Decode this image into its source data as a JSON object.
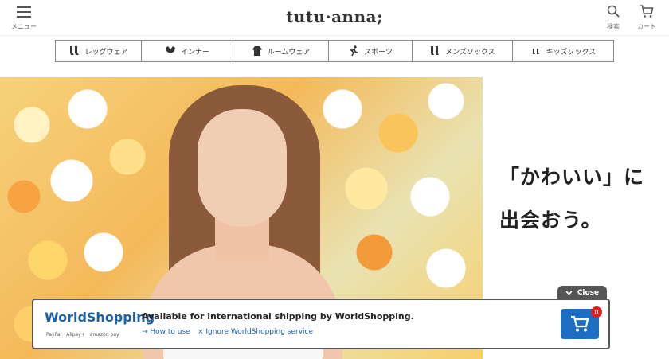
{
  "header": {
    "logo_text": "tutu·anna;",
    "menu_label": "メニュー",
    "search_label": "検索",
    "cart_label": "カート"
  },
  "categories": [
    {
      "label": "レッグウェア",
      "icon": "legwear-icon"
    },
    {
      "label": "インナー",
      "icon": "inner-icon"
    },
    {
      "label": "ルームウェア",
      "icon": "roomwear-icon"
    },
    {
      "label": "スポーツ",
      "icon": "sports-icon"
    },
    {
      "label": "メンズソックス",
      "icon": "mens-socks-icon"
    },
    {
      "label": "キッズソックス",
      "icon": "kids-socks-icon"
    }
  ],
  "hero": {
    "tagline_line1": "「かわいい」に",
    "tagline_line2": "出会おう。"
  },
  "worldshopping": {
    "close_label": "Close",
    "logo": "WorldShopping",
    "payments": [
      "PayPal",
      "Alipay+",
      "amazon pay"
    ],
    "title": "Available for international shipping by WorldShopping.",
    "link_how": "→ How to use",
    "link_ignore": "× Ignore WorldShopping service",
    "cart_count": "0",
    "accent_color": "#1b6ec2",
    "badge_color": "#e02020"
  }
}
